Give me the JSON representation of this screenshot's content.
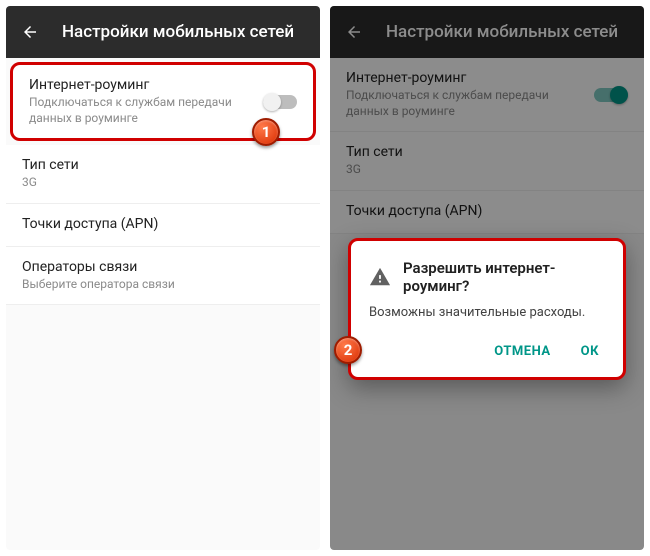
{
  "left": {
    "appbar_title": "Настройки мобильных сетей",
    "rows": {
      "roaming": {
        "title": "Интернет-роуминг",
        "subtitle": "Подключаться к службам передачи данных в роуминге",
        "switch_on": false
      },
      "network_type": {
        "title": "Тип сети",
        "subtitle": "3G"
      },
      "apn": {
        "title": "Точки доступа (APN)"
      },
      "operators": {
        "title": "Операторы связи",
        "subtitle": "Выберите оператора связи"
      }
    },
    "badge": "1"
  },
  "right": {
    "appbar_title": "Настройки мобильных сетей",
    "rows": {
      "roaming": {
        "title": "Интернет-роуминг",
        "subtitle": "Подключаться к службам передачи данных в роуминге",
        "switch_on": true
      },
      "network_type": {
        "title": "Тип сети",
        "subtitle": "3G"
      },
      "apn": {
        "title": "Точки доступа (APN)"
      }
    },
    "dialog": {
      "title": "Разрешить интернет-роуминг?",
      "message": "Возможны значительные расходы.",
      "cancel": "ОТМЕНА",
      "ok": "ОК"
    },
    "badge": "2"
  }
}
